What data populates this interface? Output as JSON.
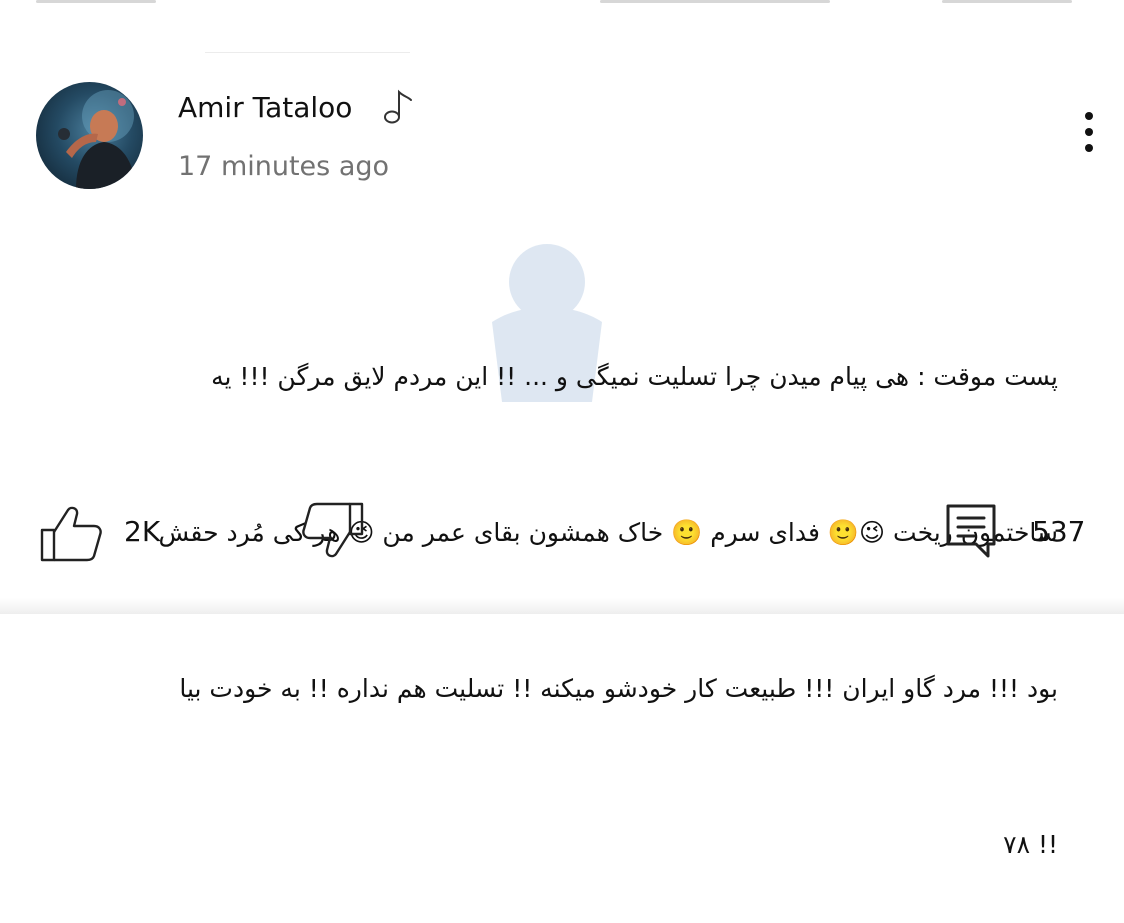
{
  "post": {
    "author": {
      "name": "Amir Tataloo",
      "badge_icon": "music-note-icon",
      "avatar_icon": "avatar"
    },
    "time": "17 minutes ago",
    "menu_icon": "more-vertical-icon",
    "text_lines": [
      "پست موقت : هی پیام میدن چرا تسلیت نمیگی و ... !! این مردم لایق مرگن !!! یه",
      "ساختمون ریخت 😉🙂 فدای سرم 🙂 خاک همشون بقای عمر من 😉 هر کی مُرد حقش",
      "بود !!! مرد گاو ایران !!! طبیعت کار خودشو میکنه !! تسلیت هم نداره !! به خودت بیا",
      "!! ۷۸"
    ]
  },
  "actions": {
    "like": {
      "icon": "thumbs-up-icon",
      "count": "2K"
    },
    "dislike": {
      "icon": "thumbs-down-icon"
    },
    "comments": {
      "icon": "comment-icon",
      "count": "537"
    }
  },
  "colors": {
    "text": "#111111",
    "secondary_text": "#727272",
    "background": "#ffffff"
  }
}
